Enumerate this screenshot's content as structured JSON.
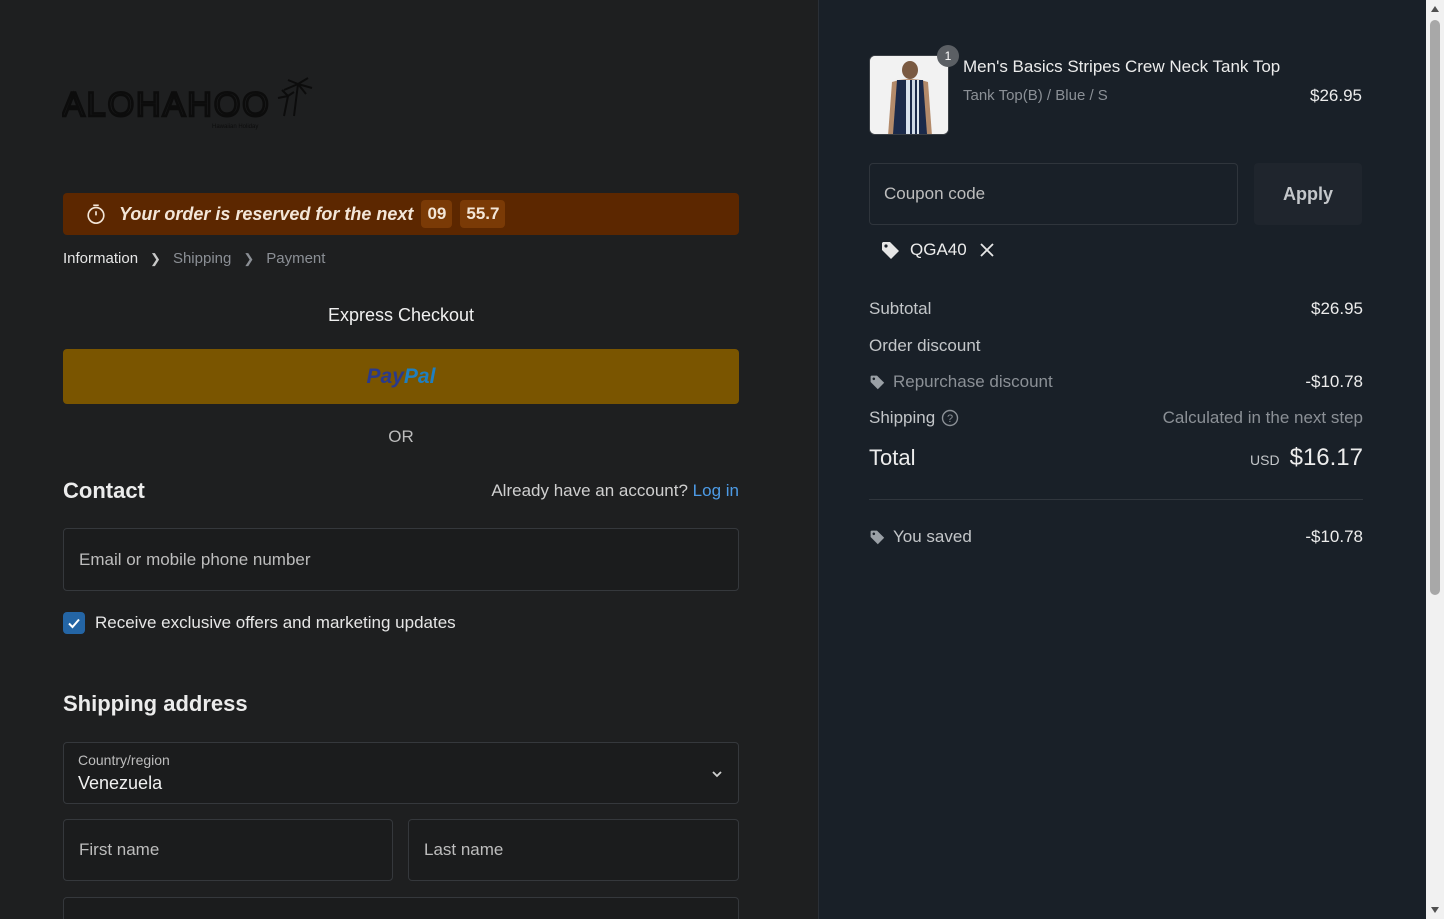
{
  "brand": {
    "logo_text": "ALOHAHOO",
    "logo_tagline": "Hawaiian Holiday"
  },
  "timer": {
    "text": "Your order is reserved for the next",
    "minutes": "09",
    "seconds": "55.7"
  },
  "breadcrumb": {
    "step1": "Information",
    "step2": "Shipping",
    "step3": "Payment"
  },
  "express": {
    "title": "Express Checkout",
    "paypal_part1": "Pay",
    "paypal_part2": "Pal",
    "or": "OR"
  },
  "contact": {
    "title": "Contact",
    "account_prompt": "Already have an account?",
    "login_link": "Log in",
    "email_placeholder": "Email or mobile phone number",
    "offers_label": "Receive exclusive offers and marketing updates",
    "offers_checked": true
  },
  "shipping_address": {
    "title": "Shipping address",
    "country_label": "Country/region",
    "country_value": "Venezuela",
    "first_name_placeholder": "First name",
    "last_name_placeholder": "Last name"
  },
  "cart": {
    "item": {
      "quantity": "1",
      "name": "Men's Basics Stripes Crew Neck Tank Top",
      "variant": "Tank Top(B) / Blue / S",
      "price": "$26.95"
    },
    "coupon_placeholder": "Coupon code",
    "apply_label": "Apply",
    "applied_code": "QGA40"
  },
  "summary": {
    "subtotal_label": "Subtotal",
    "subtotal_value": "$26.95",
    "order_discount_label": "Order discount",
    "repurchase_label": "Repurchase discount",
    "repurchase_value": "-$10.78",
    "shipping_label": "Shipping",
    "shipping_value": "Calculated in the next step",
    "total_label": "Total",
    "total_currency": "USD",
    "total_value": "$16.17",
    "saved_label": "You saved",
    "saved_value": "-$10.78"
  },
  "colors": {
    "timer_bg": "#5c2700",
    "paypal_bg": "#7a5500",
    "link": "#4d9be6",
    "checkbox": "#2465a5"
  }
}
